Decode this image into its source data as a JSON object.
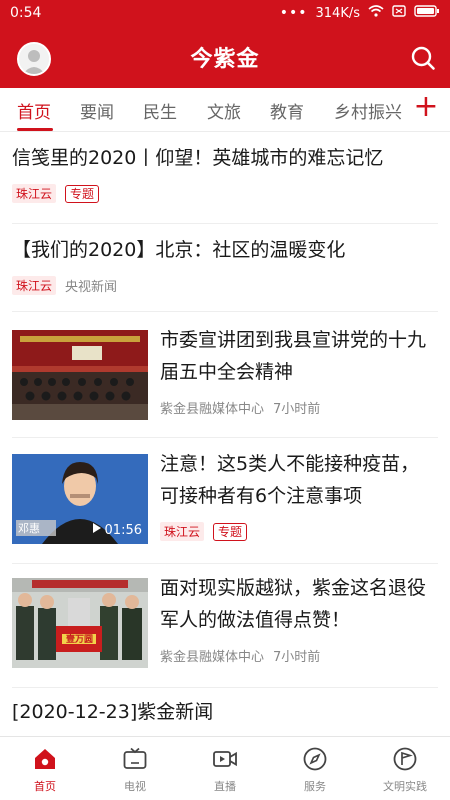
{
  "status_bar": {
    "time": "0:54",
    "dots": "•••",
    "network_speed": "314K/s",
    "icons": [
      "wifi-icon",
      "sim-icon",
      "battery-icon"
    ]
  },
  "header": {
    "title": "今紫金",
    "background_color": "#d0121c",
    "avatar_icon": "user-avatar-icon",
    "search_icon": "search-icon"
  },
  "tabs": {
    "items": [
      "首页",
      "要闻",
      "民生",
      "文旅",
      "教育",
      "乡村振兴"
    ],
    "active_index": 0,
    "add_icon": "plus-icon"
  },
  "feed": {
    "items": [
      {
        "title": "信笺里的2020丨仰望！英雄城市的难忘记忆",
        "source": "珠江云",
        "tag": "专题"
      },
      {
        "title": "【我们的2020】北京：社区的温暖变化",
        "source": "珠江云",
        "origin": "央视新闻"
      },
      {
        "title": "市委宣讲团到我县宣讲党的十九届五中全会精神",
        "source": "紫金县融媒体中心",
        "time": "7小时前",
        "thumbnail": "meeting-hall-photo"
      },
      {
        "title": "注意！这5类人不能接种疫苗，可接种者有6个注意事项",
        "source": "珠江云",
        "tag": "专题",
        "thumbnail": "press-conference-video",
        "video_duration": "01:56",
        "thumb_caption": "邓惠"
      },
      {
        "title": "面对现实版越狱，紫金这名退役军人的做法值得点赞！",
        "source": "紫金县融媒体中心",
        "time": "7小时前",
        "thumbnail": "award-ceremony-photo",
        "thumb_banner": "壹万圆"
      },
      {
        "title": "[2020-12-23]紫金新闻"
      }
    ]
  },
  "bottom_nav": {
    "items": [
      {
        "label": "首页",
        "icon": "home-icon"
      },
      {
        "label": "电视",
        "icon": "tv-icon"
      },
      {
        "label": "直播",
        "icon": "live-video-icon"
      },
      {
        "label": "服务",
        "icon": "compass-icon"
      },
      {
        "label": "文明实践",
        "icon": "flag-icon"
      }
    ],
    "active_index": 0
  }
}
